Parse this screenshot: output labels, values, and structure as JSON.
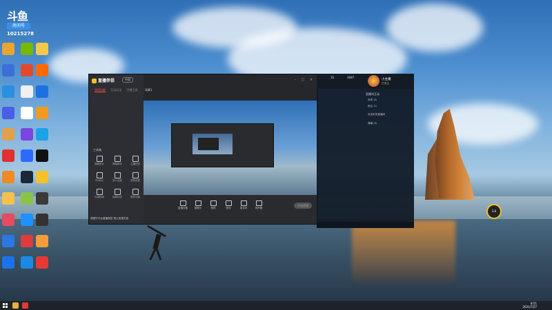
{
  "desktop": {
    "logo_text": "斗鱼",
    "room_label": "房间号",
    "room_number": "10215278",
    "icons": [
      {
        "name": "app-1",
        "color": "#e8a530"
      },
      {
        "name": "app-2",
        "color": "#76b900"
      },
      {
        "name": "app-3",
        "color": "#f2c94c"
      },
      {
        "name": "app-4",
        "color": "#3d6fd6"
      },
      {
        "name": "app-5",
        "color": "#e04b2f"
      },
      {
        "name": "app-6",
        "color": "#ff6a00"
      },
      {
        "name": "app-7",
        "color": "#2a8fe0"
      },
      {
        "name": "app-8",
        "color": "#f0f0f0"
      },
      {
        "name": "app-9",
        "color": "#1e6fe0"
      },
      {
        "name": "app-10",
        "color": "#4a5ee8"
      },
      {
        "name": "app-11",
        "color": "#ffffff"
      },
      {
        "name": "app-12",
        "color": "#f29a1f"
      },
      {
        "name": "app-13",
        "color": "#e2a04a"
      },
      {
        "name": "app-14",
        "color": "#7a45e0"
      },
      {
        "name": "app-15",
        "color": "#1ba3e8"
      },
      {
        "name": "app-16",
        "color": "#e03030"
      },
      {
        "name": "app-17",
        "color": "#2d6bff"
      },
      {
        "name": "app-18",
        "color": "#111111"
      },
      {
        "name": "app-19",
        "color": "#f08a24"
      },
      {
        "name": "app-20",
        "color": "#1b2838"
      },
      {
        "name": "app-21",
        "color": "#f4c12a"
      },
      {
        "name": "app-22",
        "color": "#f6c14a"
      },
      {
        "name": "app-23",
        "color": "#8bc34a"
      },
      {
        "name": "app-24",
        "color": "#3a3a3a"
      },
      {
        "name": "app-25",
        "color": "#e84a5f"
      },
      {
        "name": "app-26",
        "color": "#1e90ff"
      },
      {
        "name": "app-27",
        "color": "#333333"
      },
      {
        "name": "app-28",
        "color": "#2b78e4"
      },
      {
        "name": "app-29",
        "color": "#e03b3b"
      },
      {
        "name": "app-30",
        "color": "#f19d3b"
      },
      {
        "name": "app-31",
        "color": "#1a73e8"
      },
      {
        "name": "app-32",
        "color": "#1e88e5"
      },
      {
        "name": "app-33",
        "color": "#e53935"
      }
    ]
  },
  "live_app": {
    "brand": "直播伴侣",
    "tag": "中国",
    "tabs": [
      "常用功能",
      "互动玩法",
      "开播工具"
    ],
    "tools_label": "工具箱",
    "tools": [
      "观看统计",
      "弹幕助手",
      "主播任务",
      "PK玩法",
      "多人连麦",
      "语音连麦",
      "礼物特效",
      "连麦玩法",
      "更多功能"
    ],
    "scene": "场景1",
    "bottom_buttons": [
      "直播设置",
      "摄像头",
      "美颜",
      "音效",
      "麦克风",
      "扬声器"
    ],
    "start_button": "开始直播",
    "notice": "请遵守平台直播规范 禁止违规内容"
  },
  "chat_panel": {
    "stats": [
      {
        "label": "16"
      },
      {
        "label": "3687"
      }
    ],
    "anchor_name": "小主播",
    "anchor_sub": "已关注",
    "list_title": "直播间互动",
    "items": [
      "贵宾 (0)",
      "粉丝 (1)",
      "欢迎来到直播间",
      "弹幕 (0)"
    ]
  },
  "taskbar": {
    "time": "8:51",
    "date": "2021/7/27"
  },
  "float_ball": {
    "value": "3.6"
  }
}
